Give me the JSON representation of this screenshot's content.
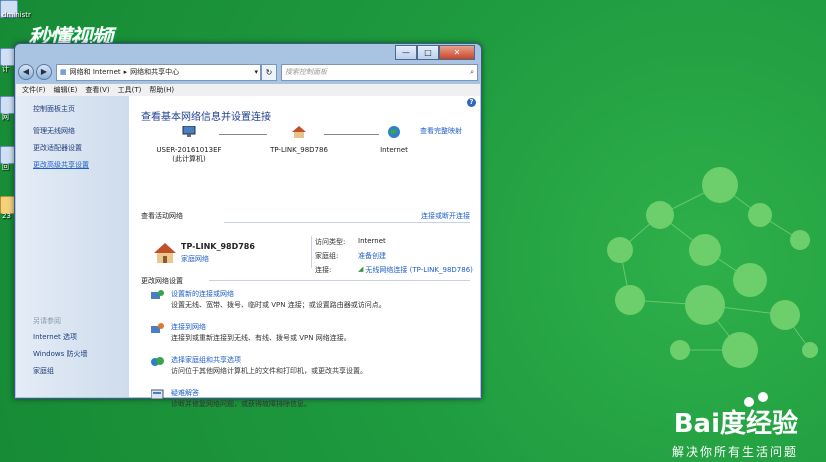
{
  "desktop": {
    "watermark_logo": "秒懂视频",
    "icons": [
      {
        "label": "dministr",
        "icon": "user-folder-icon"
      },
      {
        "label": "计",
        "icon": "computer-icon"
      },
      {
        "label": "网",
        "icon": "network-icon"
      },
      {
        "label": "回",
        "icon": "recycle-bin-icon"
      },
      {
        "label": "23",
        "icon": "folder-icon"
      }
    ],
    "baidu_brand": "Bai度经验",
    "baidu_slogan": "解决你所有生活问题"
  },
  "window": {
    "controls": {
      "minimize": "—",
      "maximize": "□",
      "close": "✕"
    },
    "address": {
      "crumbs": [
        "网络和 Internet",
        "网络和共享中心"
      ],
      "search_placeholder": "搜索控制面板"
    },
    "menu": [
      "文件(F)",
      "编辑(E)",
      "查看(V)",
      "工具(T)",
      "帮助(H)"
    ],
    "sidebar": {
      "home": "控制面板主页",
      "items": [
        "管理无线网络",
        "更改适配器设置",
        "更改高级共享设置"
      ],
      "see_also_header": "另请参阅",
      "see_also": [
        "Internet 选项",
        "Windows 防火墙",
        "家庭组"
      ]
    },
    "main": {
      "title": "查看基本网络信息并设置连接",
      "full_map": "查看完整映射",
      "nodes": [
        {
          "name": "USER-20161013EF",
          "sub": "(此计算机)"
        },
        {
          "name": "TP-LINK_98D786",
          "sub": ""
        },
        {
          "name": "Internet",
          "sub": ""
        }
      ],
      "active_header": "查看活动网络",
      "connect_link": "连接或断开连接",
      "active": {
        "name": "TP-LINK_98D786",
        "type": "家庭网络",
        "access_type_label": "访问类型:",
        "access_type_value": "Internet",
        "homegroup_label": "家庭组:",
        "homegroup_value": "准备创建",
        "connection_label": "连接:",
        "connection_value": "无线网络连接 (TP-LINK_98D786)"
      },
      "change_header": "更改网络设置",
      "tasks": [
        {
          "title": "设置新的连接或网络",
          "desc": "设置无线、宽带、拨号、临时或 VPN 连接；或设置路由器或访问点。",
          "icon": "new-connection-icon"
        },
        {
          "title": "连接到网络",
          "desc": "连接到或重新连接到无线、有线、拨号或 VPN 网络连接。",
          "icon": "connect-network-icon"
        },
        {
          "title": "选择家庭组和共享选项",
          "desc": "访问位于其他网络计算机上的文件和打印机，或更改共享设置。",
          "icon": "homegroup-icon"
        },
        {
          "title": "疑难解答",
          "desc": "诊断并修复网络问题，或获得故障排除信息。",
          "icon": "troubleshoot-icon"
        }
      ]
    }
  },
  "colors": {
    "desktop_green": "#1e9a3f",
    "link_blue": "#1f5fc8",
    "title_blue": "#1f3f8f"
  }
}
